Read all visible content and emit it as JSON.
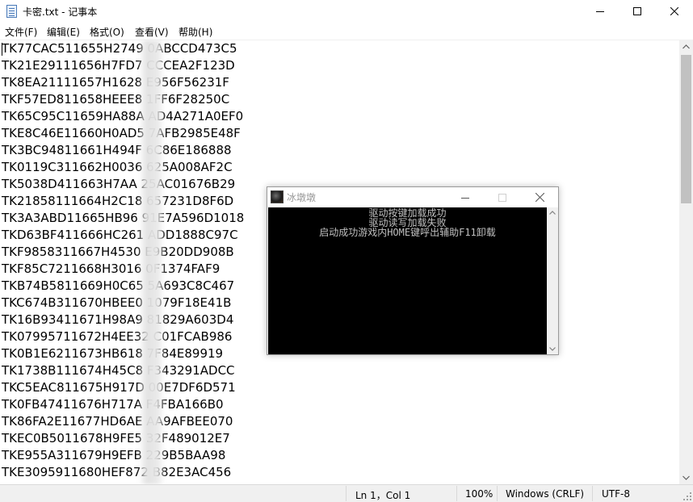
{
  "window": {
    "title": "卡密.txt - 记事本",
    "controls": {
      "minimize": "minimize-icon",
      "maximize": "maximize-icon",
      "close": "close-icon"
    }
  },
  "menu": [
    "文件(F)",
    "编辑(E)",
    "格式(O)",
    "查看(V)",
    "帮助(H)"
  ],
  "editor": {
    "lines": [
      "TK77CAC511655H2749   0ABCCD473C5",
      "TK21E29111656H7FD7   CCCEA2F123D",
      "TK8EA21111657H1628   E956F56231F",
      "TKF57ED811658HEEE8   1FF6F28250C",
      "TK65C95C11659HA88A   AD4A271A0EF0",
      "TKE8C46E11660H0AD5   7AFB2985E48F",
      "TK3BC94811661H494F   6C86E186888",
      "TK0119C311662H0036   625A008AF2C",
      "TK5038D411663H7AA    25AC01676B29",
      "TK21858111664H2C18   657231D8F6D",
      "TK3A3ABD11665HB96    91E7A596D1018",
      "TKD63BF411666HC261   ADD1888C97C",
      "TKF9858311667H4530   E9B20DD908B",
      "TKF85C7211668H3016   0F1374FAF9",
      "TKB74B5811669H0C65   5A693C8C467",
      "TKC674B311670HBEE0   1079F18E41B",
      "TK16B93411671H98A9   81829A603D4",
      "TK07995711672H4EE32  C01FCAB986",
      "TK0B1E6211673HB618   7F84E89919",
      "TK1738B111674H45C8   F343291ADCC",
      "TKC5EAC811675H917D   00E7DF6D571",
      "TK0FB47411676H717A   F4FBA166B0",
      "TK86FA2E11677HD6AE   AA9AFBEE070",
      "TKEC0B5011678H9FE5   32F489012E7",
      "TKE955A311679H9EFB   229B5BAA98",
      "TKE3095911680HEF872  B82E3AC456"
    ]
  },
  "status": {
    "position": "Ln 1，Col 1",
    "zoom": "100%",
    "line_ending": "Windows (CRLF)",
    "encoding": "UTF-8"
  },
  "console": {
    "title": "冰墩墩",
    "lines": [
      "驱动按键加载成功",
      "驱动读写加载失败",
      "启动成功游戏内HOME键呼出辅助F11卸载"
    ]
  }
}
